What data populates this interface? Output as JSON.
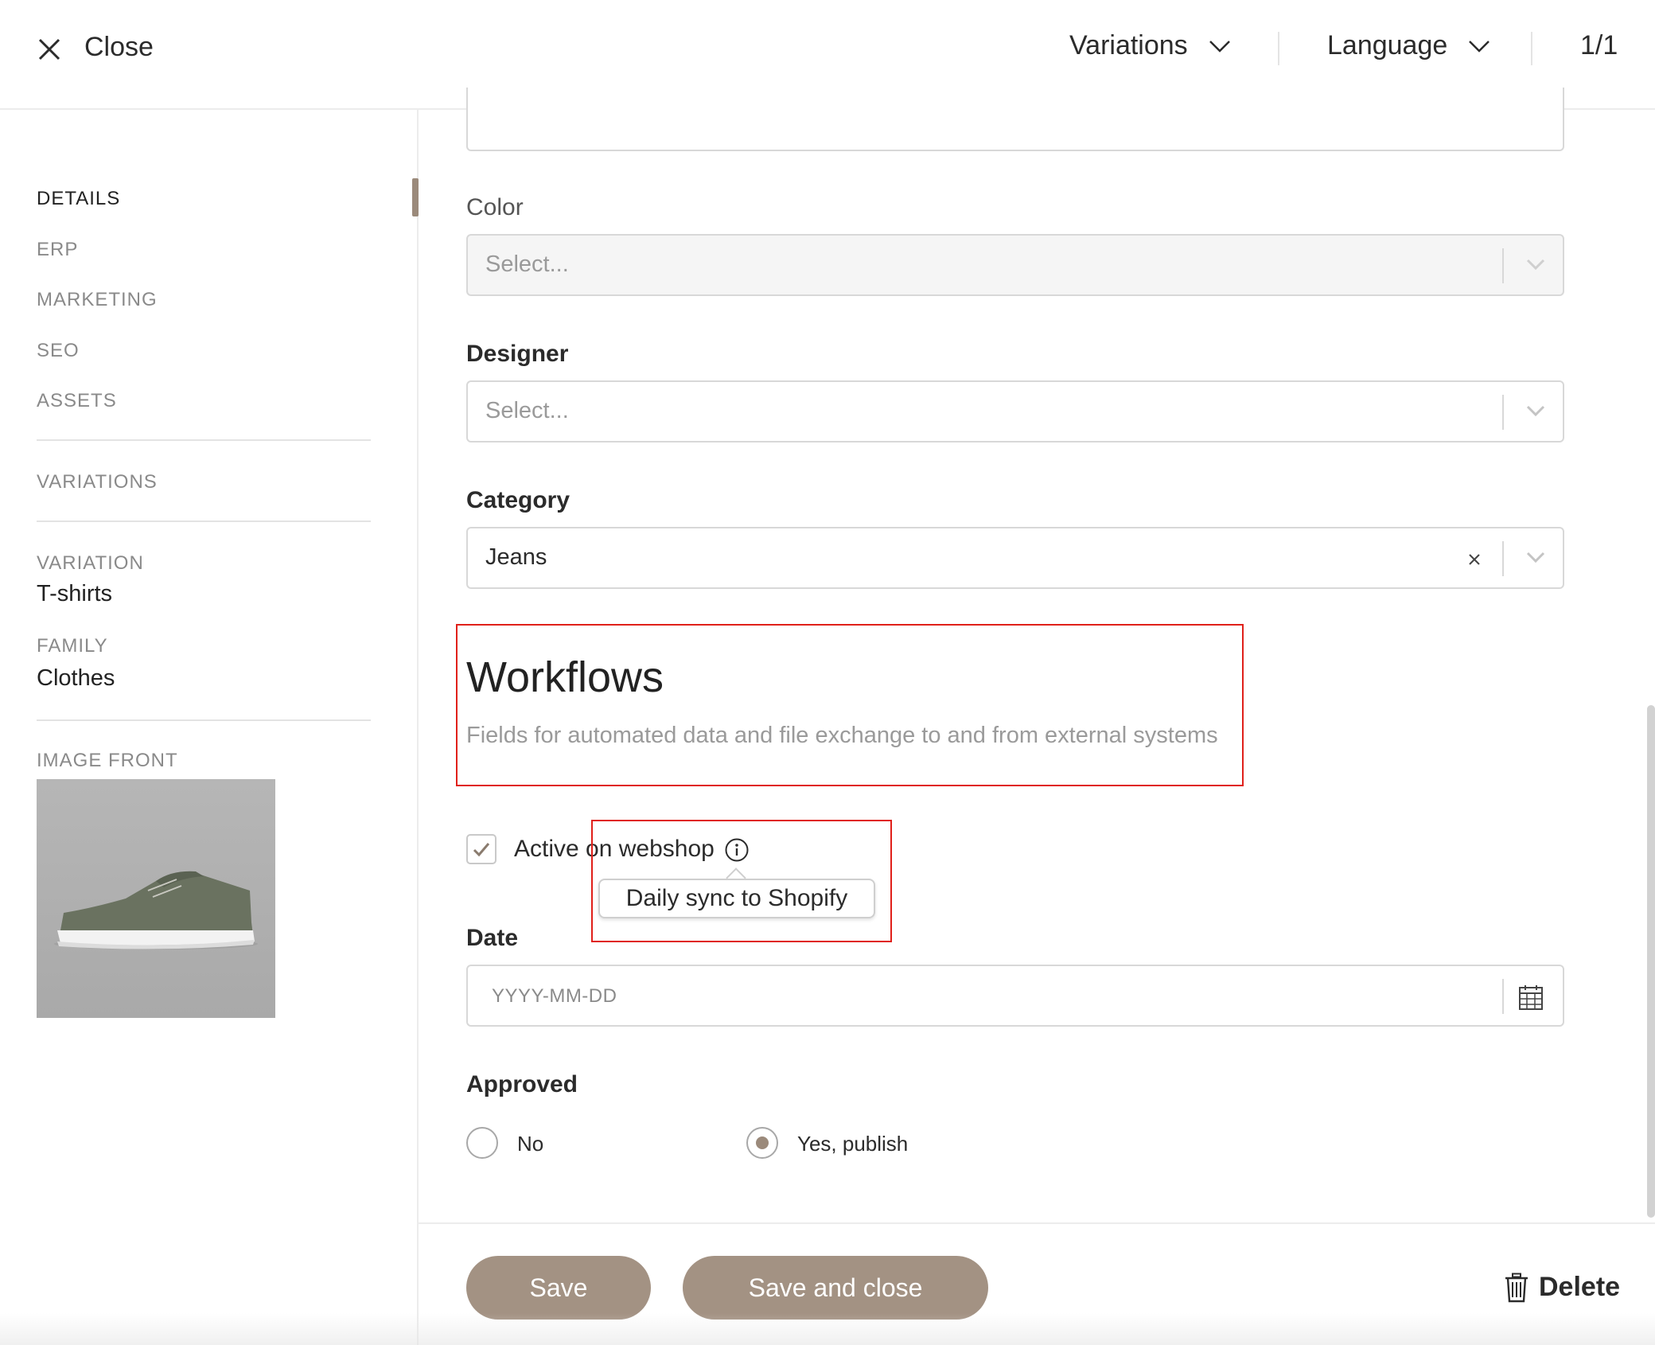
{
  "header": {
    "close_label": "Close",
    "variations_label": "Variations",
    "language_label": "Language",
    "pagination": "1/1"
  },
  "sidebar": {
    "nav": [
      "DETAILS",
      "ERP",
      "MARKETING",
      "SEO",
      "ASSETS"
    ],
    "variations_label": "VARIATIONS",
    "variation_label": "VARIATION",
    "variation_value": "T-shirts",
    "family_label": "FAMILY",
    "family_value": "Clothes",
    "image_label": "IMAGE FRONT"
  },
  "form": {
    "color": {
      "label": "Color",
      "placeholder": "Select..."
    },
    "designer": {
      "label": "Designer",
      "placeholder": "Select..."
    },
    "category": {
      "label": "Category",
      "value": "Jeans"
    },
    "workflows": {
      "title": "Workflows",
      "description": "Fields for automated data and file exchange to and from external systems"
    },
    "active_webshop": {
      "label": "Active on webshop",
      "checked": true,
      "tooltip": "Daily sync to Shopify"
    },
    "date": {
      "label": "Date",
      "placeholder": "YYYY-MM-DD"
    },
    "approved": {
      "label": "Approved",
      "options": [
        "No",
        "Yes, publish"
      ],
      "selected": "Yes, publish"
    }
  },
  "footer": {
    "save_label": "Save",
    "save_close_label": "Save and close",
    "delete_label": "Delete"
  },
  "colors": {
    "accent": "#a39283",
    "highlight": "#e0201a"
  }
}
